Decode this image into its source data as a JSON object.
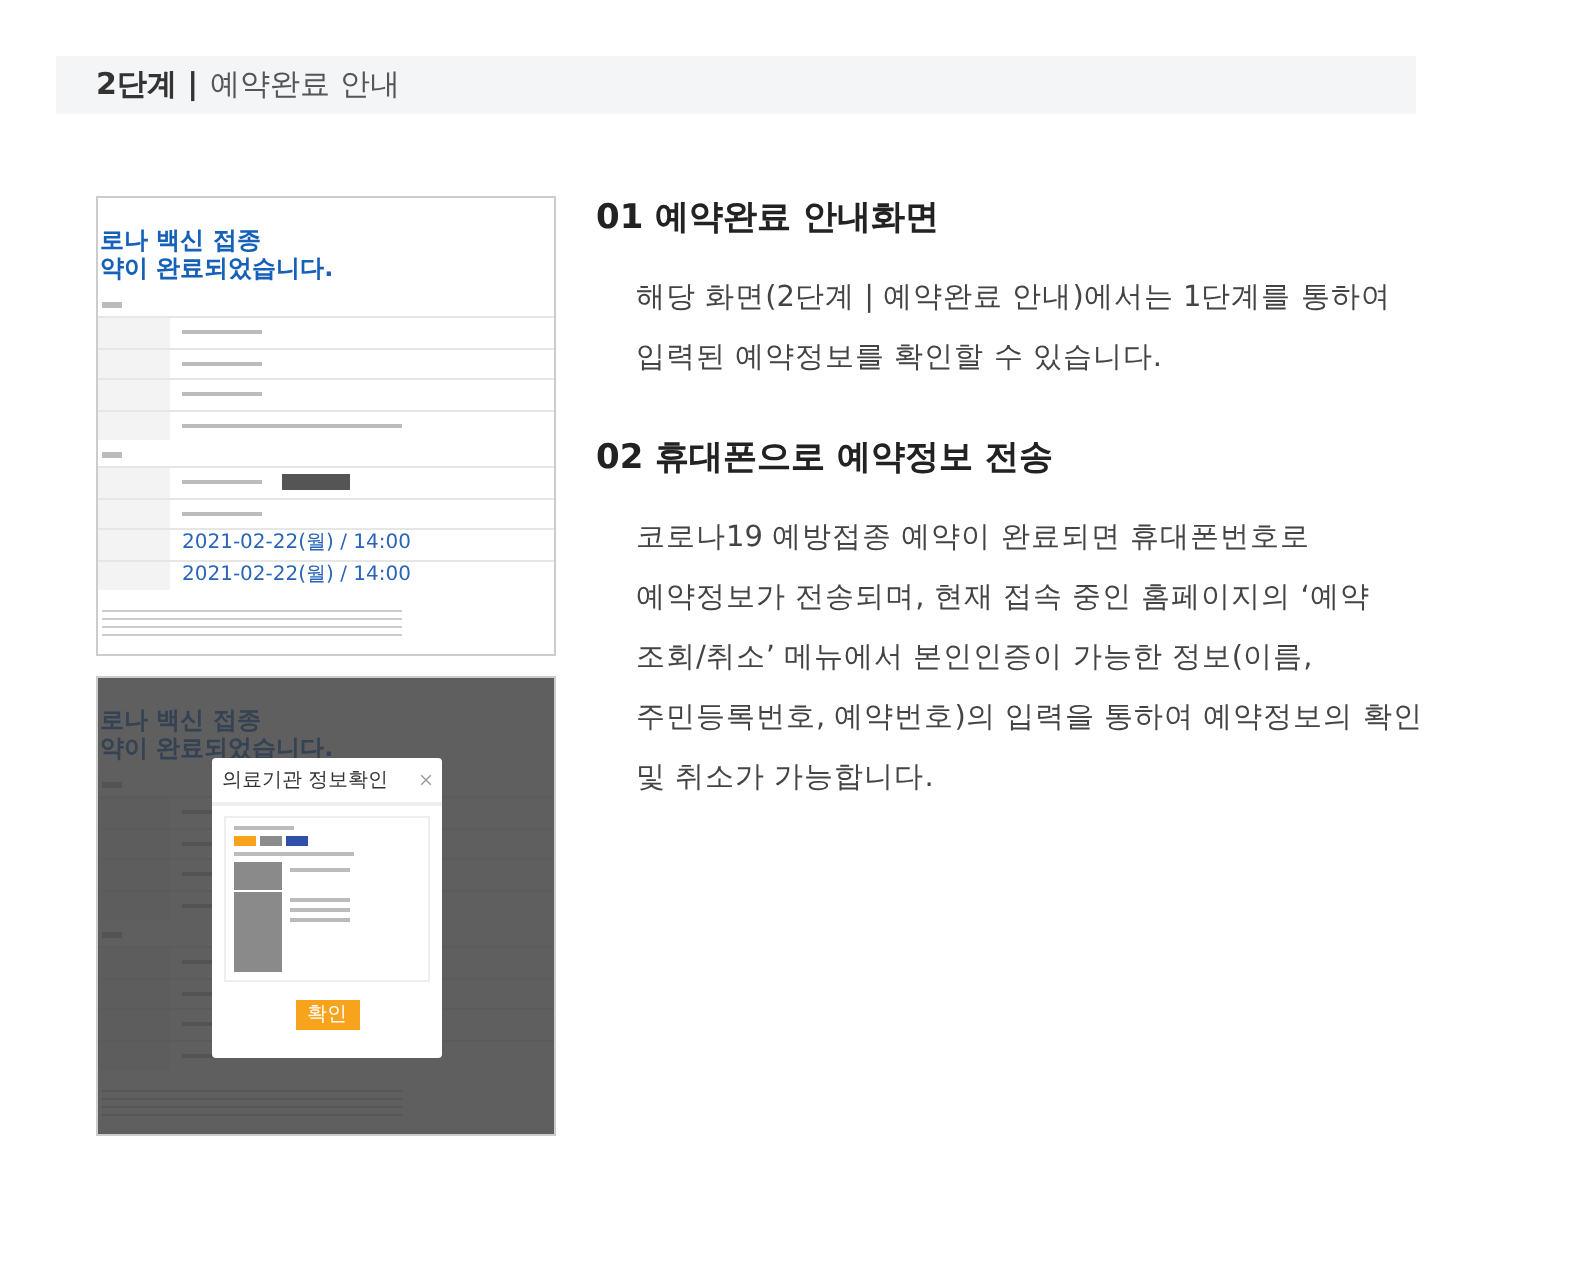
{
  "section_header": {
    "step": "2단계 |",
    "title": "예약완료 안내"
  },
  "screenshots": [
    {
      "kind": "completion",
      "headline": [
        "로나 백신 접종",
        "약이 완료되었습니다."
      ],
      "dates": [
        "2021-02-22(월) / 14:00",
        "2021-02-22(월) / 14:00"
      ]
    },
    {
      "kind": "modal",
      "headline": [
        "로나 백신 접종",
        "약이 완료되었습니다."
      ],
      "modal_title": "의료기관 정보확인",
      "modal_button": "확인"
    }
  ],
  "sections": [
    {
      "title": "01 예약완료 안내화면",
      "lines": [
        "해당 화면(2단계 | 예약완료 안내)에서는 1단계를 통하여",
        "입력된 예약정보를 확인할 수 있습니다."
      ]
    },
    {
      "title": "02 휴대폰으로 예약정보 전송",
      "lines": [
        "코로나19 예방접종 예약이 완료되면 휴대폰번호로",
        "예약정보가 전송되며, 현재 접속 중인 홈페이지의 ‘예약",
        "조회/취소’ 메뉴에서 본인인증이 가능한 정보(이름,",
        "주민등록번호, 예약번호)의 입력을 통하여 예약정보의 확인",
        "및 취소가 가능합니다."
      ]
    }
  ]
}
